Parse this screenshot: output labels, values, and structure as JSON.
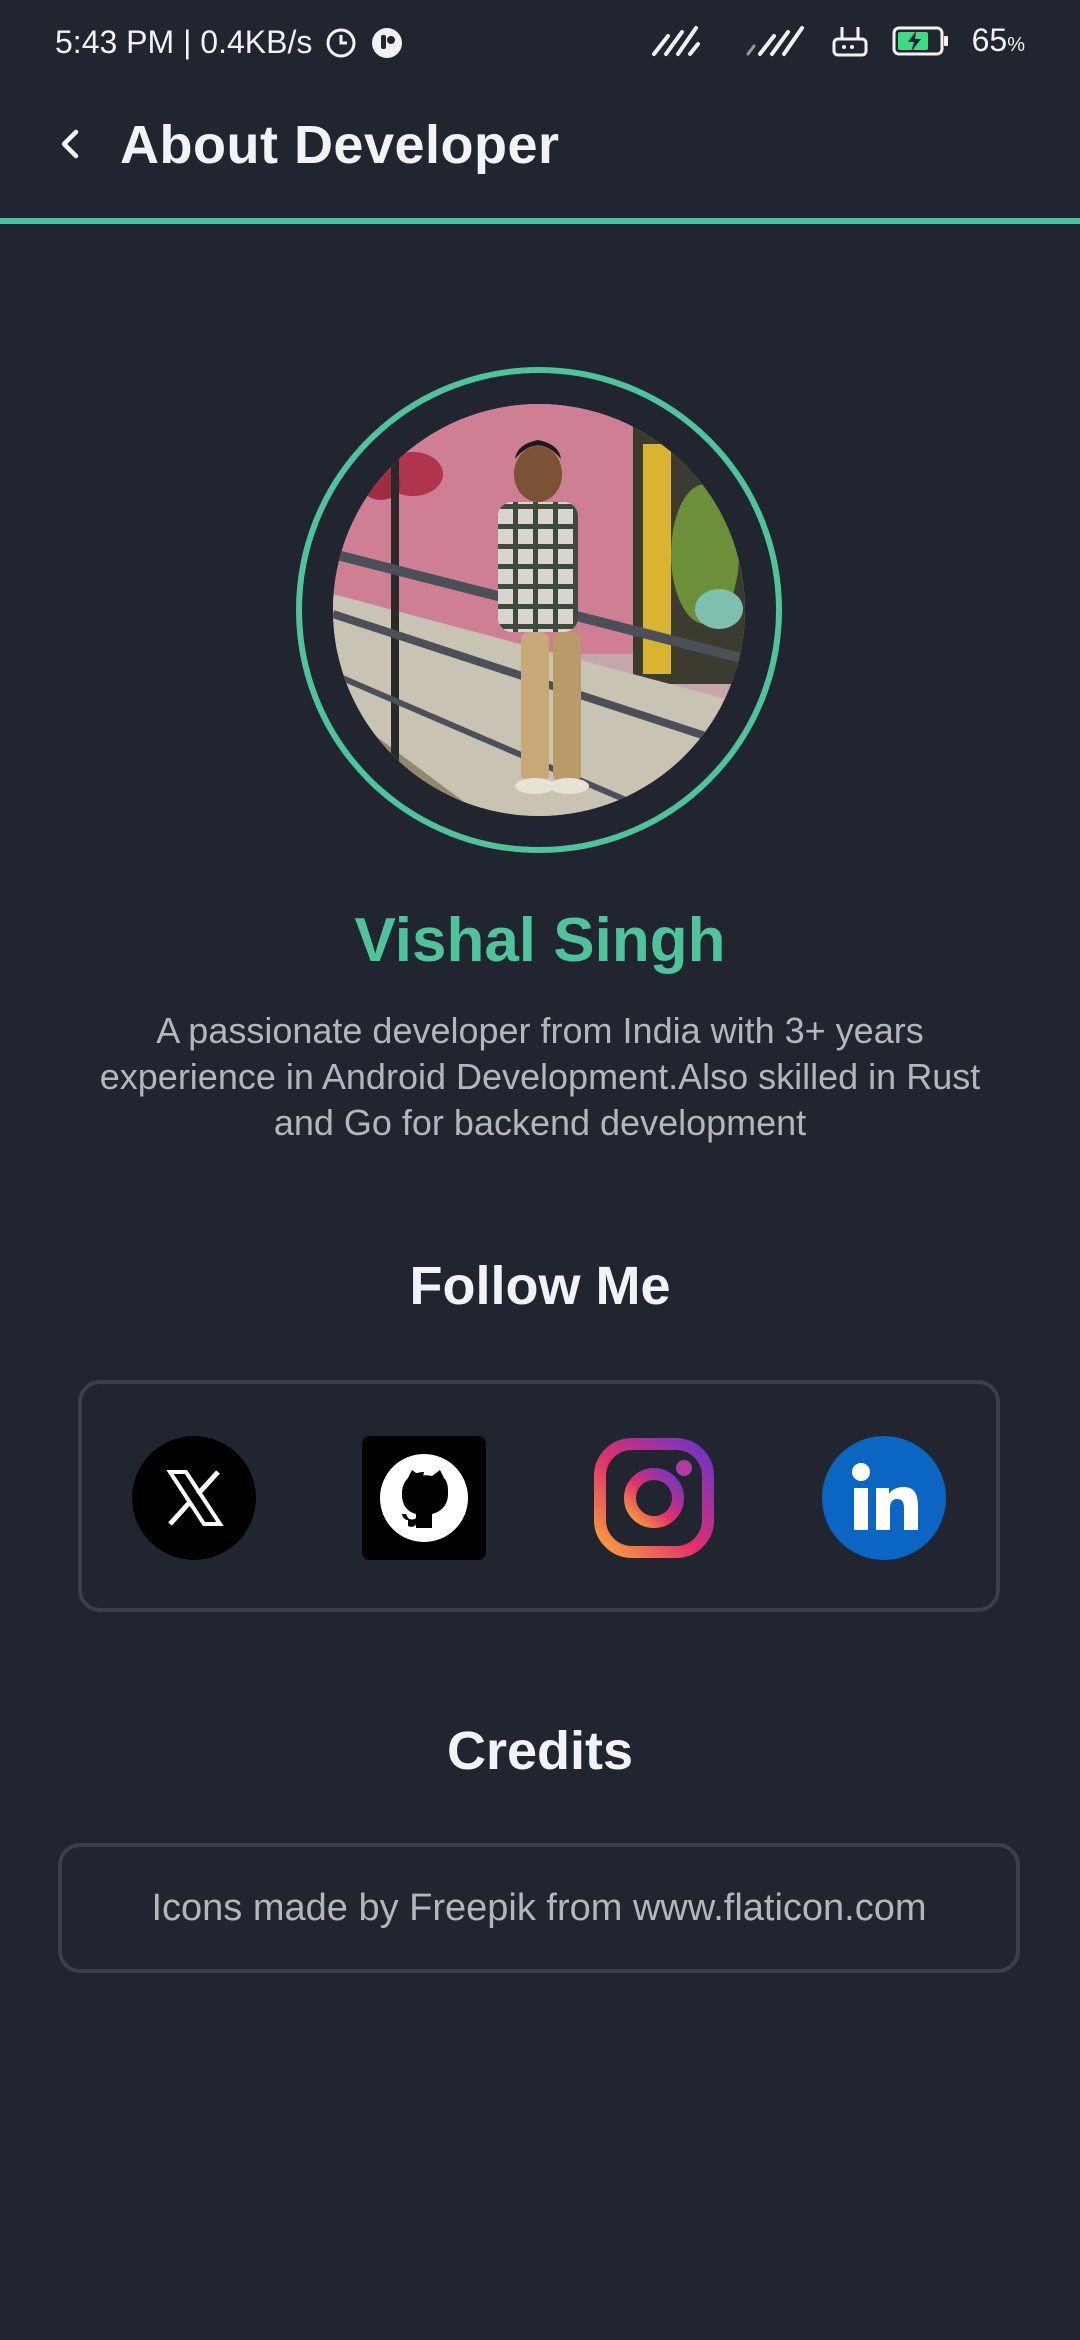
{
  "status_bar": {
    "time_speed": "5:43 PM | 0.4KB/s",
    "battery": "65",
    "battery_unit": "%"
  },
  "toolbar": {
    "title": "About Developer",
    "back_icon": "chevron-left-icon"
  },
  "profile": {
    "name": "Vishal Singh",
    "bio": "A passionate developer from India with 3+ years experience in Android Development.Also skilled in Rust and Go for backend development"
  },
  "follow": {
    "title": "Follow Me",
    "links": [
      {
        "name": "X",
        "icon": "x-twitter-icon"
      },
      {
        "name": "GitHub",
        "icon": "github-icon"
      },
      {
        "name": "Instagram",
        "icon": "instagram-icon"
      },
      {
        "name": "LinkedIn",
        "icon": "linkedin-icon"
      }
    ]
  },
  "credits": {
    "title": "Credits",
    "text": "Icons made by Freepik from www.flaticon.com"
  },
  "colors": {
    "background": "#21252f",
    "accent": "#4fc39a",
    "card_border": "#3a3f4b",
    "muted_text": "#b3b6bd"
  }
}
